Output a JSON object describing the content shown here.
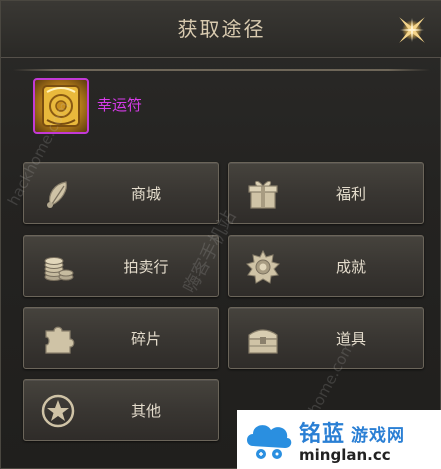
{
  "dialog": {
    "title": "获取途径"
  },
  "item": {
    "name": "幸运符"
  },
  "buttons": [
    {
      "label": "商城",
      "icon": "shop-feather-icon"
    },
    {
      "label": "福利",
      "icon": "gift-box-icon"
    },
    {
      "label": "拍卖行",
      "icon": "coin-stack-icon"
    },
    {
      "label": "成就",
      "icon": "achievement-badge-icon"
    },
    {
      "label": "碎片",
      "icon": "puzzle-piece-icon"
    },
    {
      "label": "道具",
      "icon": "treasure-chest-icon"
    },
    {
      "label": "其他",
      "icon": "star-circle-icon"
    }
  ],
  "watermarks": {
    "left": "hackhome.com",
    "mid": "嗨客手机站",
    "right": "hackhome.com"
  },
  "logo": {
    "cn_name": "铭蓝",
    "cn_sub": "游戏网",
    "url": "minglan.cc"
  },
  "colors": {
    "rare_item": "#d63be8",
    "label": "#e4dccc",
    "title": "#d9cbb0"
  }
}
